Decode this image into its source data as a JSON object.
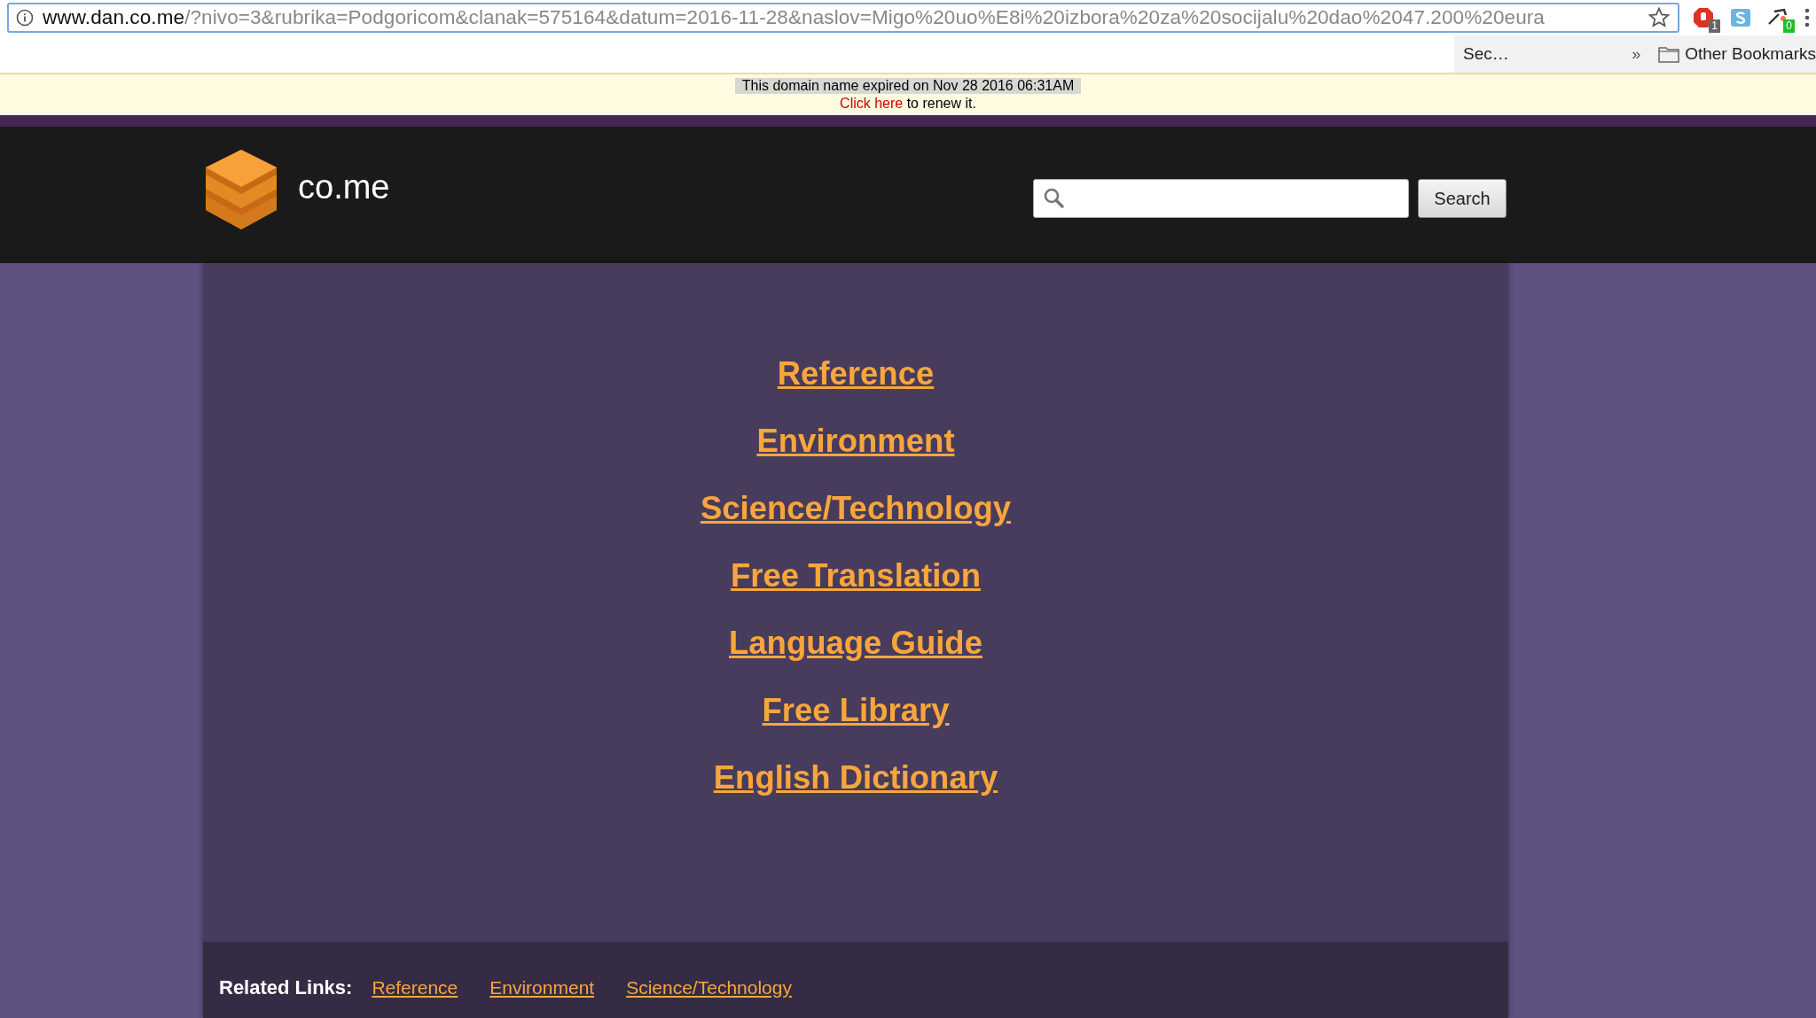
{
  "browser": {
    "url_host": "www.dan.co.me",
    "url_path": "/?nivo=3&rubrika=Podgoricom&clanak=575164&datum=2016-11-28&naslov=Migo%20uo%E8i%20izbora%20za%20socijalu%20dao%2047.200%20eura",
    "extensions": [
      {
        "kind": "stop",
        "badge": "1"
      },
      {
        "kind": "s"
      },
      {
        "kind": "tool",
        "badge": "0"
      }
    ],
    "bookmarks": [
      {
        "label": "Sec…"
      }
    ],
    "overflow": "»",
    "other_bookmarks": "Other Bookmarks"
  },
  "notice": {
    "message": "This domain name expired on Nov 28 2016 06:31AM",
    "link": "Click here",
    "rest": " to renew it."
  },
  "header": {
    "logo_text": "co.me",
    "search_button": "Search"
  },
  "links": [
    "Reference",
    "Environment",
    "Science/Technology",
    "Free Translation",
    "Language Guide",
    "Free Library",
    "English Dictionary"
  ],
  "related": {
    "label": "Related Links:",
    "links": [
      "Reference",
      "Environment",
      "Science/Technology"
    ]
  }
}
